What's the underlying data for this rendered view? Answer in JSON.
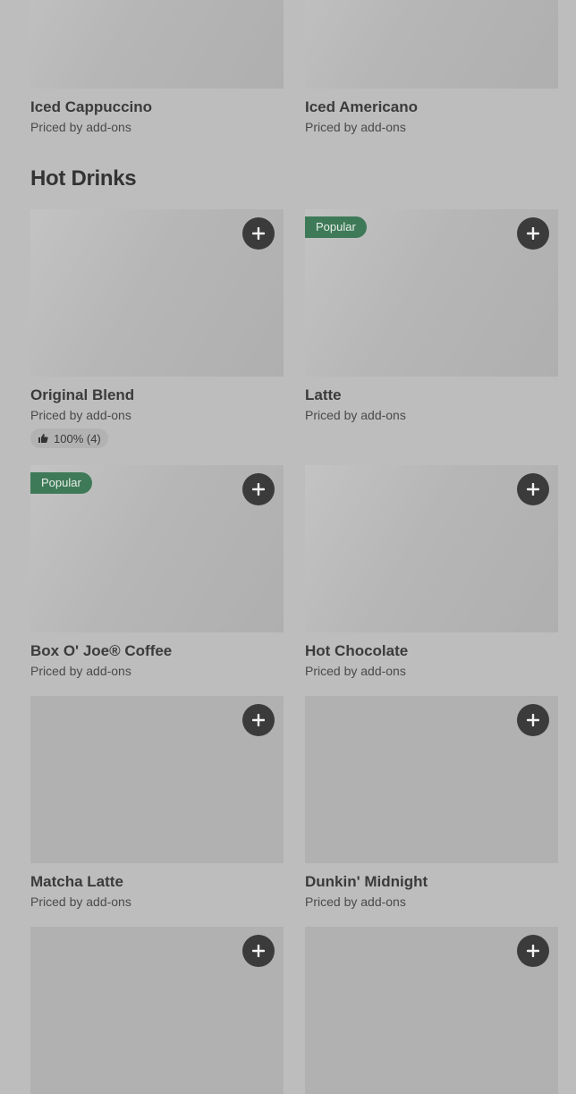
{
  "top_items": [
    {
      "name": "Iced Cappuccino",
      "price": "Priced by add-ons"
    },
    {
      "name": "Iced Americano",
      "price": "Priced by add-ons"
    }
  ],
  "section": {
    "title": "Hot Drinks"
  },
  "items": [
    {
      "name": "Original Blend",
      "price": "Priced by add-ons",
      "rating": "100% (4)",
      "badge": ""
    },
    {
      "name": "Latte",
      "price": "Priced by add-ons",
      "badge": "Popular"
    },
    {
      "name": "Box O' Joe® Coffee",
      "price": "Priced by add-ons",
      "badge": "Popular"
    },
    {
      "name": "Hot Chocolate",
      "price": "Priced by add-ons",
      "badge": ""
    },
    {
      "name": "Matcha Latte",
      "price": "Priced by add-ons",
      "badge": ""
    },
    {
      "name": "Dunkin' Midnight",
      "price": "Priced by add-ons",
      "badge": ""
    }
  ],
  "icons": {
    "add": "plus-icon",
    "thumbs_up": "thumbs-up-icon"
  },
  "colors": {
    "badge": "#3f7a58",
    "add_button": "#3b3b3b",
    "background": "#bdbdbd"
  }
}
